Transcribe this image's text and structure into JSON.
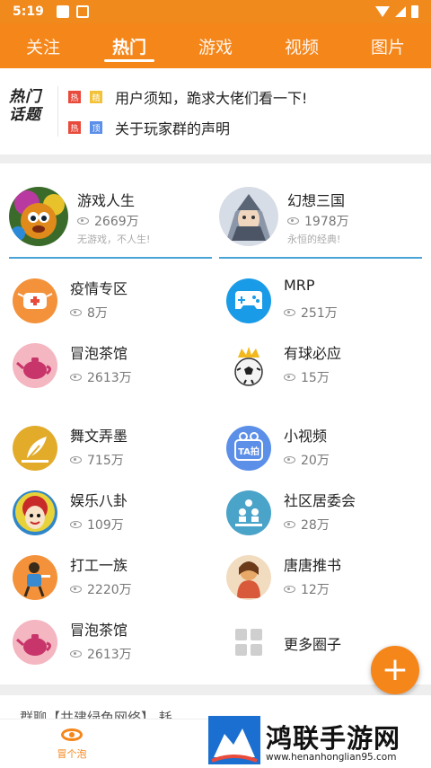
{
  "status_bar": {
    "time": "5:19"
  },
  "top_nav": {
    "tabs": [
      {
        "label": "关注",
        "active": false
      },
      {
        "label": "热门",
        "active": true
      },
      {
        "label": "游戏",
        "active": false
      },
      {
        "label": "视频",
        "active": false
      },
      {
        "label": "图片",
        "active": false
      }
    ]
  },
  "hot_topics": {
    "logo_line1": "热门",
    "logo_line2": "话题",
    "items": [
      {
        "tags": [
          "热",
          "精"
        ],
        "text": "用户须知，跪求大佬们看一下!"
      },
      {
        "tags": [
          "热",
          "顶"
        ],
        "text": "关于玩家群的声明"
      }
    ]
  },
  "featured": [
    {
      "name": "游戏人生",
      "count": "2669万",
      "slogan": "无游戏，不人生!"
    },
    {
      "name": "幻想三国",
      "count": "1978万",
      "slogan": "永恒的经典!"
    }
  ],
  "circles": [
    {
      "name": "疫情专区",
      "count": "8万",
      "icon": "mask-icon"
    },
    {
      "name": "MRP",
      "count": "251万",
      "icon": "gamepad-icon"
    },
    {
      "name": "冒泡茶馆",
      "count": "2613万",
      "icon": "teapot-icon"
    },
    {
      "name": "有球必应",
      "count": "15万",
      "icon": "football-icon"
    },
    {
      "name": "舞文弄墨",
      "count": "715万",
      "icon": "quill-icon"
    },
    {
      "name": "小视频",
      "count": "20万",
      "icon": "ta-video-icon",
      "icon_text": "TA拍"
    },
    {
      "name": "娱乐八卦",
      "count": "109万",
      "icon": "opera-mask-icon"
    },
    {
      "name": "社区居委会",
      "count": "28万",
      "icon": "community-icon"
    },
    {
      "name": "打工一族",
      "count": "2220万",
      "icon": "worker-icon"
    },
    {
      "name": "唐唐推书",
      "count": "12万",
      "icon": "book-girl-icon"
    },
    {
      "name": "冒泡茶馆",
      "count": "2613万",
      "icon": "teapot-icon"
    }
  ],
  "more_circles_label": "更多圈子",
  "chat_preview": "群聊【共建绿色网络】 耗",
  "bottom_nav": {
    "label": "冒个泡"
  },
  "watermark": {
    "title": "鸿联手游网",
    "url": "www.henanhonglian95.com"
  },
  "colors": {
    "brand": "#f5861a",
    "accent_blue": "#4aa3d6"
  }
}
